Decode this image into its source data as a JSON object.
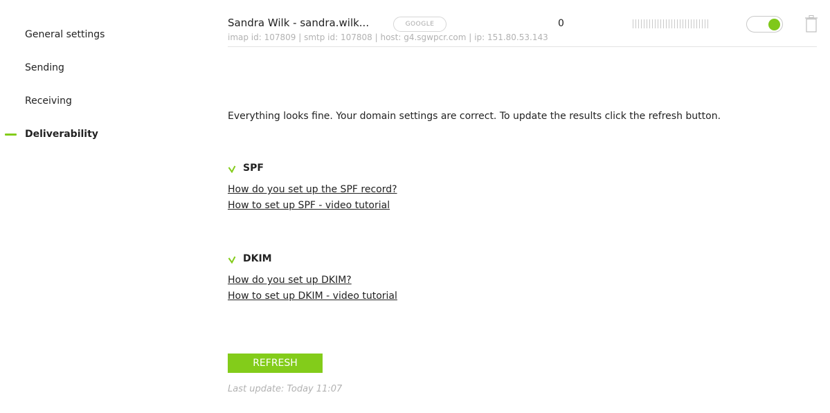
{
  "sidebar": {
    "items": [
      {
        "label": "General settings",
        "active": false
      },
      {
        "label": "Sending",
        "active": false
      },
      {
        "label": "Receiving",
        "active": false
      },
      {
        "label": "Deliverability",
        "active": true
      }
    ],
    "accent_color": "#83cc1a"
  },
  "account": {
    "name": "Sandra Wilk - sandra.wilk...",
    "provider_badge": "GOOGLE",
    "count": "0",
    "meta": "imap id: 107809 | smtp id: 107808 | host: g4.sgwpcr.com | ip: 151.80.53.143",
    "enabled": true,
    "toggle_icon": "toggle-switch",
    "delete_icon": "trash-icon"
  },
  "main": {
    "status_message": "Everything looks fine. Your domain settings are correct. To update the results click the refresh button.",
    "checks": [
      {
        "title": "SPF",
        "status_icon": "check-icon",
        "links": [
          "How do you set up the SPF record?",
          "How to set up SPF - video tutorial"
        ]
      },
      {
        "title": "DKIM",
        "status_icon": "check-icon",
        "links": [
          "How do you set up DKIM?",
          "How to set up DKIM - video tutorial"
        ]
      }
    ],
    "refresh_label": "REFRESH",
    "last_update": "Last update: Today 11:07"
  }
}
